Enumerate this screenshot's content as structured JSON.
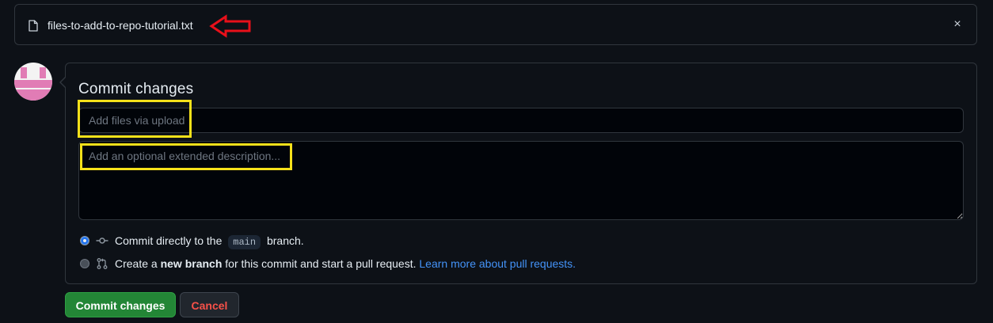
{
  "file": {
    "name": "files-to-add-to-repo-tutorial.txt",
    "icon": "file-icon",
    "close_icon": "×"
  },
  "commit": {
    "title": "Commit changes",
    "summary_placeholder": "Add files via upload",
    "description_placeholder": "Add an optional extended description..."
  },
  "options": {
    "direct": {
      "selected": true,
      "prefix": "Commit directly to the",
      "branch": "main",
      "suffix": "branch."
    },
    "new_branch": {
      "selected": false,
      "prefix": "Create a",
      "bold": "new branch",
      "middle": "for this commit and start a pull request.",
      "link": "Learn more about pull requests."
    }
  },
  "buttons": {
    "commit": "Commit changes",
    "cancel": "Cancel"
  },
  "colors": {
    "annotation_arrow": "#e8101a",
    "annotation_box": "#f5e11a",
    "primary_button": "#238636",
    "cancel_text": "#f85149",
    "link": "#4493f8"
  }
}
